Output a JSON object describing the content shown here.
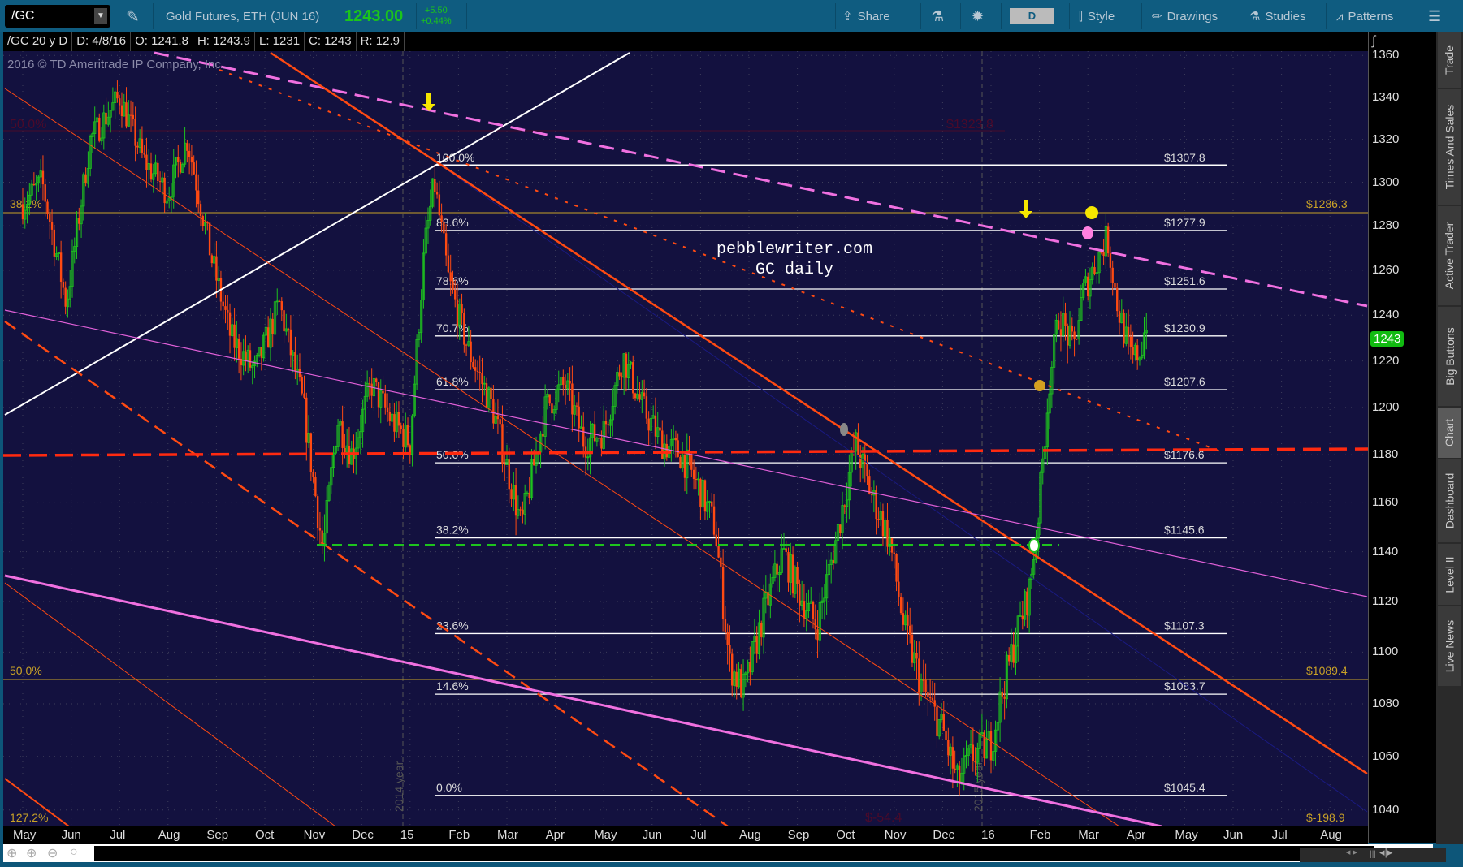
{
  "toolbar": {
    "symbol": "/GC",
    "description": "Gold Futures, ETH (JUN 16)",
    "last": "1243.00",
    "change": "+5.50",
    "change_pct": "+0.44%",
    "share": "Share",
    "timeframe": "D",
    "style": "Style",
    "drawings": "Drawings",
    "studies": "Studies",
    "patterns": "Patterns"
  },
  "info": {
    "symbol": "/GC 20 y D",
    "date": "D: 4/8/16",
    "open": "O: 1241.8",
    "high": "H: 1243.9",
    "low": "L: 1231",
    "close": "C: 1243",
    "range": "R: 12.9"
  },
  "copyright": "2016 © TD Ameritrade IP Company, Inc.",
  "watermark": {
    "line1": "pebblewriter.com",
    "line2": "GC daily"
  },
  "side_tabs": [
    "Trade",
    "Times And Sales",
    "Active Trader",
    "Big Buttons",
    "Chart",
    "Dashboard",
    "Level II",
    "Live News"
  ],
  "colors": {
    "up": "#1ec31e",
    "down": "#ff4a12",
    "fib": "#ffffff",
    "gold": "#c9a227",
    "bg": "#13113f"
  },
  "chart_data": {
    "type": "candlestick",
    "title": "/GC 20 y D",
    "yscale": "log",
    "ylim": [
      1030,
      1365
    ],
    "y_ticks": [
      1360,
      1340,
      1320,
      1300,
      1280,
      1260,
      1240,
      1220,
      1200,
      1180,
      1160,
      1140,
      1120,
      1100,
      1080,
      1060,
      1040
    ],
    "x_ticks": [
      "May",
      "Jun",
      "Jul",
      "Aug",
      "Sep",
      "Oct",
      "Nov",
      "Dec",
      "15",
      "Feb",
      "Mar",
      "Apr",
      "May",
      "Jun",
      "Jul",
      "Aug",
      "Sep",
      "Oct",
      "Nov",
      "Dec",
      "16",
      "Feb",
      "Mar",
      "Apr",
      "May",
      "Jun",
      "Jul",
      "Aug"
    ],
    "price_path_months_since_may2014": [
      [
        0,
        1290
      ],
      [
        0.4,
        1300
      ],
      [
        0.9,
        1245
      ],
      [
        1.4,
        1320
      ],
      [
        2.0,
        1340
      ],
      [
        2.5,
        1310
      ],
      [
        3.0,
        1295
      ],
      [
        3.4,
        1320
      ],
      [
        3.9,
        1265
      ],
      [
        4.3,
        1230
      ],
      [
        4.8,
        1215
      ],
      [
        5.3,
        1245
      ],
      [
        5.8,
        1200
      ],
      [
        6.2,
        1140
      ],
      [
        6.5,
        1195
      ],
      [
        6.8,
        1180
      ],
      [
        7.2,
        1210
      ],
      [
        7.6,
        1195
      ],
      [
        8.0,
        1185
      ],
      [
        8.3,
        1270
      ],
      [
        8.5,
        1300
      ],
      [
        8.8,
        1255
      ],
      [
        9.2,
        1225
      ],
      [
        9.7,
        1200
      ],
      [
        10.3,
        1150
      ],
      [
        10.8,
        1200
      ],
      [
        11.2,
        1210
      ],
      [
        11.6,
        1185
      ],
      [
        12.0,
        1190
      ],
      [
        12.4,
        1222
      ],
      [
        12.8,
        1200
      ],
      [
        13.2,
        1185
      ],
      [
        13.6,
        1180
      ],
      [
        14.0,
        1165
      ],
      [
        14.3,
        1150
      ],
      [
        14.6,
        1095
      ],
      [
        14.9,
        1085
      ],
      [
        15.3,
        1115
      ],
      [
        15.7,
        1140
      ],
      [
        16.0,
        1125
      ],
      [
        16.4,
        1110
      ],
      [
        16.8,
        1145
      ],
      [
        17.2,
        1185
      ],
      [
        17.5,
        1165
      ],
      [
        17.9,
        1145
      ],
      [
        18.2,
        1110
      ],
      [
        18.6,
        1085
      ],
      [
        19.0,
        1070
      ],
      [
        19.3,
        1050
      ],
      [
        19.6,
        1060
      ],
      [
        20.0,
        1065
      ],
      [
        20.3,
        1090
      ],
      [
        20.5,
        1105
      ],
      [
        20.8,
        1125
      ],
      [
        21.0,
        1160
      ],
      [
        21.2,
        1210
      ],
      [
        21.4,
        1240
      ],
      [
        21.7,
        1225
      ],
      [
        21.9,
        1250
      ],
      [
        22.2,
        1265
      ],
      [
        22.4,
        1275
      ],
      [
        22.6,
        1245
      ],
      [
        22.9,
        1220
      ],
      [
        23.1,
        1225
      ],
      [
        23.25,
        1243
      ]
    ],
    "fib_levels": [
      {
        "pct": "100.0%",
        "price": 1307.8,
        "label": "$1307.8"
      },
      {
        "pct": "88.6%",
        "price": 1277.9,
        "label": "$1277.9"
      },
      {
        "pct": "78.6%",
        "price": 1251.6,
        "label": "$1251.6"
      },
      {
        "pct": "70.7%",
        "price": 1230.9,
        "label": "$1230.9"
      },
      {
        "pct": "61.8%",
        "price": 1207.6,
        "label": "$1207.6"
      },
      {
        "pct": "50.0%",
        "price": 1176.6,
        "label": "$1176.6"
      },
      {
        "pct": "38.2%",
        "price": 1145.6,
        "label": "$1145.6"
      },
      {
        "pct": "23.6%",
        "price": 1107.3,
        "label": "$1107.3"
      },
      {
        "pct": "14.6%",
        "price": 1083.7,
        "label": "$1083.7"
      },
      {
        "pct": "0.0%",
        "price": 1045.4,
        "label": "$1045.4"
      }
    ],
    "gold_levels": [
      {
        "pct": "38.2%",
        "price": 1286.3,
        "label": "$1286.3"
      },
      {
        "pct": "50.0%",
        "price": 1089.4,
        "label": "$1089.4"
      },
      {
        "pct": "127.2%",
        "label": "$-198.9"
      }
    ],
    "faint_levels": [
      {
        "pct": "50.0%",
        "label": "$1323.8"
      },
      {
        "label": "$-54.4"
      }
    ],
    "year_markers": [
      "2014 year",
      "2015 year"
    ],
    "current_price": "1243"
  }
}
